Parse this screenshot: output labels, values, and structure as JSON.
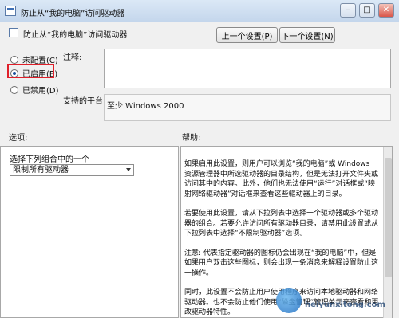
{
  "window": {
    "title": "防止从“我的电脑”访问驱动器",
    "minimize_label": "–",
    "maximize_label": "□",
    "close_label": "✕"
  },
  "header": {
    "policy_title": "防止从“我的电脑”访问驱动器",
    "prev_button": "上一个设置(P)",
    "next_button": "下一个设置(N)"
  },
  "state": {
    "options": [
      {
        "label": "未配置(C)",
        "selected": false
      },
      {
        "label": "已启用(E)",
        "selected": true
      },
      {
        "label": "已禁用(D)",
        "selected": false
      }
    ]
  },
  "comment": {
    "label": "注释:",
    "value": ""
  },
  "platform": {
    "label": "支持的平台:",
    "value": "至少 Windows 2000"
  },
  "options_pane": {
    "title": "选项:",
    "combo_label": "选择下列组合中的一个",
    "combo_value": "限制所有驱动器"
  },
  "help_pane": {
    "title": "帮助:",
    "paragraphs": [
      "如果启用此设置，则用户可以浏览“我的电脑”或 Windows 资源管理器中所选驱动器的目录结构，但是无法打开文件夹或访问其中的内容。此外，他们也无法使用“运行”对话框或“映射网络驱动器”对话框来查看这些驱动器上的目录。",
      "若要使用此设置，请从下拉列表中选择一个驱动器或多个驱动器的组合。若要允许访问所有驱动器目录，请禁用此设置或从下拉列表中选择“不限制驱动器”选项。",
      "注意: 代表指定驱动器的图标仍会出现在“我的电脑”中，但是如果用户双击这些图标，则会出现一条消息来解释设置防止这一操作。",
      "同时，此设置不会防止用户使用程序来访问本地驱动器和网络驱动器。也不会防止他们使用“磁盘管理”管理单元来查看和更改驱动器特性。"
    ]
  },
  "watermark": {
    "text": "heiyunxitong.com"
  }
}
